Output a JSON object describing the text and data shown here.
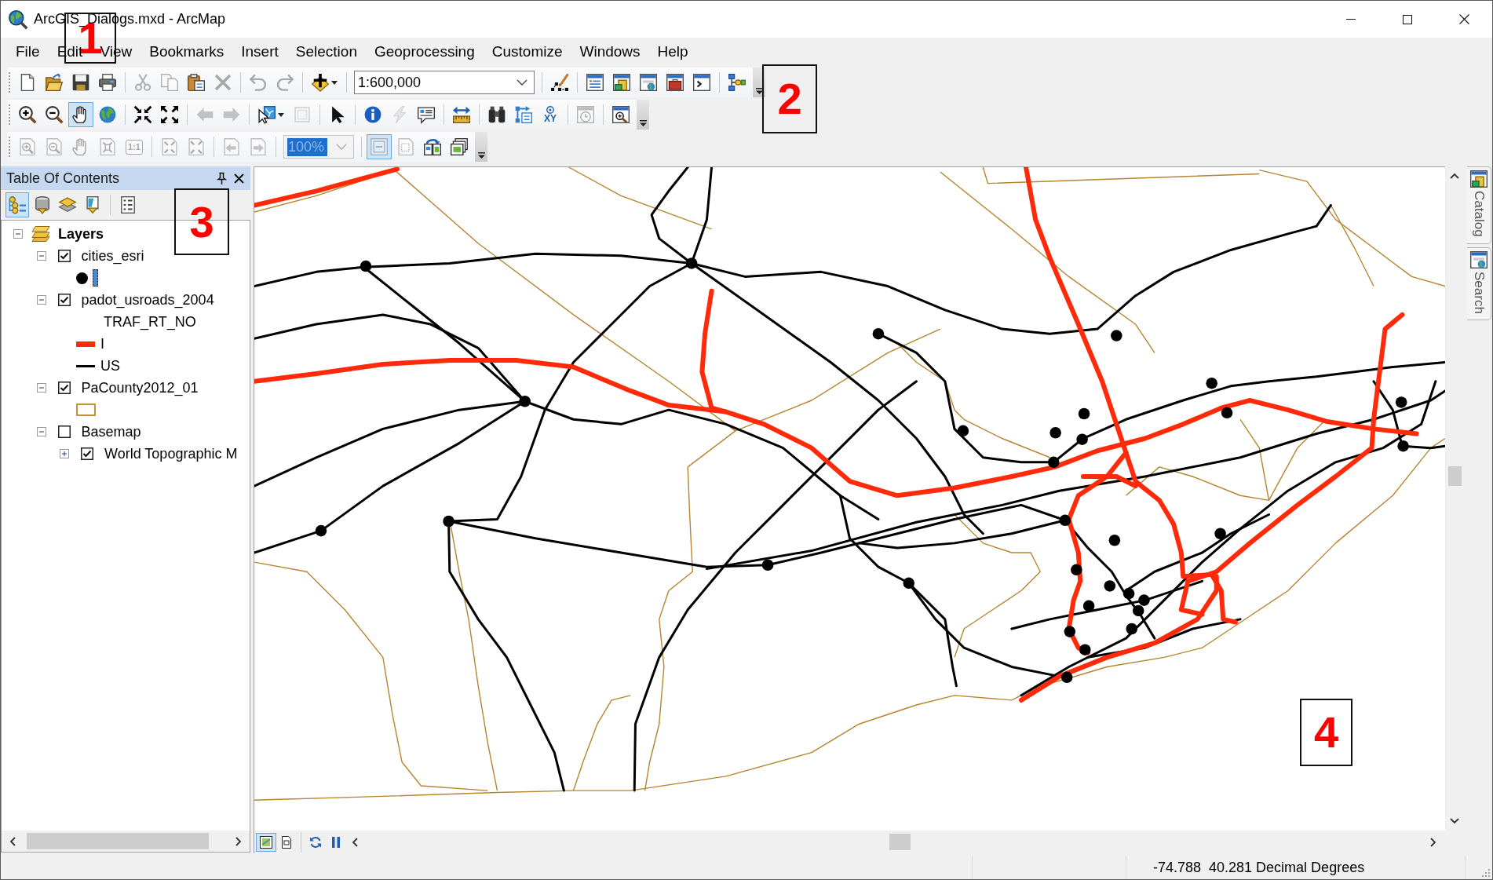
{
  "window": {
    "title": "ArcGIS_Dialogs.mxd - ArcMap"
  },
  "menu": [
    "File",
    "Edit",
    "View",
    "Bookmarks",
    "Insert",
    "Selection",
    "Geoprocessing",
    "Customize",
    "Windows",
    "Help"
  ],
  "toolbars": [
    {
      "groups": [
        [
          {
            "kind": "button",
            "disabled": false,
            "selected": false
          },
          {
            "kind": "button",
            "disabled": false,
            "selected": false
          },
          {
            "kind": "button",
            "disabled": false,
            "selected": false
          },
          {
            "kind": "button",
            "disabled": false,
            "selected": false
          }
        ],
        [
          {
            "kind": "button",
            "disabled": true,
            "selected": false
          },
          {
            "kind": "button",
            "disabled": true,
            "selected": false
          },
          {
            "kind": "button",
            "disabled": false,
            "selected": false
          },
          {
            "kind": "button",
            "disabled": true,
            "selected": false
          }
        ],
        [
          {
            "kind": "button",
            "disabled": true,
            "selected": false
          },
          {
            "kind": "button",
            "disabled": true,
            "selected": false
          }
        ],
        [
          {
            "kind": "dropdown",
            "disabled": false,
            "selected": false
          }
        ],
        [
          {
            "kind": "combo",
            "value": "1:600,000",
            "disabled": false,
            "highlighted": false
          }
        ],
        [
          {
            "kind": "button",
            "disabled": false,
            "selected": false
          }
        ],
        [
          {
            "kind": "button",
            "disabled": false,
            "selected": false
          },
          {
            "kind": "button",
            "disabled": false,
            "selected": false
          },
          {
            "kind": "button",
            "disabled": false,
            "selected": false
          },
          {
            "kind": "button",
            "disabled": false,
            "selected": false
          },
          {
            "kind": "button",
            "disabled": false,
            "selected": false
          }
        ],
        [
          {
            "kind": "button",
            "disabled": false,
            "selected": false
          }
        ]
      ]
    },
    {
      "groups": [
        [
          {
            "kind": "button",
            "disabled": false,
            "selected": false
          },
          {
            "kind": "button",
            "disabled": false,
            "selected": false
          },
          {
            "kind": "button",
            "disabled": false,
            "selected": true
          },
          {
            "kind": "button",
            "disabled": false,
            "selected": false
          }
        ],
        [
          {
            "kind": "button",
            "disabled": false,
            "selected": false
          },
          {
            "kind": "button",
            "disabled": false,
            "selected": false
          }
        ],
        [
          {
            "kind": "button",
            "disabled": true,
            "selected": false
          },
          {
            "kind": "button",
            "disabled": true,
            "selected": false
          }
        ],
        [
          {
            "kind": "dropdown",
            "disabled": false,
            "selected": false
          },
          {
            "kind": "button",
            "disabled": true,
            "selected": false
          }
        ],
        [
          {
            "kind": "button",
            "disabled": false,
            "selected": false
          }
        ],
        [
          {
            "kind": "button",
            "disabled": false,
            "selected": false
          },
          {
            "kind": "button",
            "disabled": true,
            "selected": false
          },
          {
            "kind": "button",
            "disabled": false,
            "selected": false
          }
        ],
        [
          {
            "kind": "button",
            "disabled": false,
            "selected": false
          }
        ],
        [
          {
            "kind": "button",
            "disabled": false,
            "selected": false
          },
          {
            "kind": "button",
            "disabled": false,
            "selected": false
          },
          {
            "kind": "button",
            "label": "XY",
            "disabled": false,
            "selected": false
          }
        ],
        [
          {
            "kind": "button",
            "disabled": true,
            "selected": false
          }
        ],
        [
          {
            "kind": "button",
            "disabled": false,
            "selected": false
          }
        ]
      ]
    },
    {
      "groups": [
        [
          {
            "kind": "button",
            "disabled": true,
            "selected": false
          },
          {
            "kind": "button",
            "disabled": true,
            "selected": false
          },
          {
            "kind": "button",
            "disabled": true,
            "selected": false
          },
          {
            "kind": "button",
            "disabled": true,
            "selected": false
          },
          {
            "kind": "button",
            "label": "1:1",
            "disabled": true,
            "selected": false
          }
        ],
        [
          {
            "kind": "button",
            "disabled": true,
            "selected": false
          },
          {
            "kind": "button",
            "disabled": true,
            "selected": false
          }
        ],
        [
          {
            "kind": "button",
            "disabled": true,
            "selected": false
          },
          {
            "kind": "button",
            "disabled": true,
            "selected": false
          }
        ],
        [
          {
            "kind": "combo",
            "value": "100%",
            "disabled": true,
            "highlighted": true
          }
        ],
        [
          {
            "kind": "button",
            "disabled": true,
            "selected": true
          },
          {
            "kind": "button",
            "disabled": true,
            "selected": false
          },
          {
            "kind": "button",
            "disabled": false,
            "selected": false
          },
          {
            "kind": "button",
            "disabled": false,
            "selected": false
          }
        ]
      ]
    }
  ],
  "toc": {
    "title": "Table Of Contents",
    "view_buttons": [
      {
        "selected": true
      },
      {
        "selected": false
      },
      {
        "selected": false
      },
      {
        "selected": false
      }
    ],
    "tree": [
      {
        "name": "Layers",
        "expanded": true,
        "selected": false,
        "children": [
          {
            "name": "cities_esri",
            "checked": true,
            "expanded": true,
            "selected": false,
            "legend": [
              {
                "kind": "point",
                "selected": true
              }
            ]
          },
          {
            "name": "padot_usroads_2004",
            "checked": true,
            "expanded": true,
            "selected": false,
            "field": "TRAF_RT_NO",
            "legend": [
              {
                "kind": "wide_line",
                "color": "#ff2a0a",
                "label": "I",
                "selected": false
              },
              {
                "kind": "line",
                "color": "#000000",
                "label": "US",
                "selected": false
              }
            ]
          },
          {
            "name": "PaCounty2012_01",
            "checked": true,
            "expanded": true,
            "selected": false,
            "legend": [
              {
                "kind": "polygon",
                "selected": false
              }
            ]
          },
          {
            "name": "Basemap",
            "checked": false,
            "expanded": true,
            "selected": false,
            "children": [
              {
                "name": "World Topographic M",
                "checked": true,
                "expanded": false,
                "selected": false
              }
            ]
          }
        ]
      }
    ]
  },
  "map": {
    "view_buttons": [
      {
        "selected": true
      },
      {
        "selected": false
      }
    ]
  },
  "dock_tabs": [
    {
      "label": "Catalog"
    },
    {
      "label": "Search"
    }
  ],
  "status_bar": {
    "coordinates": "-74.788  40.281 Decimal Degrees"
  },
  "callouts": [
    "1",
    "2",
    "3",
    "4"
  ]
}
